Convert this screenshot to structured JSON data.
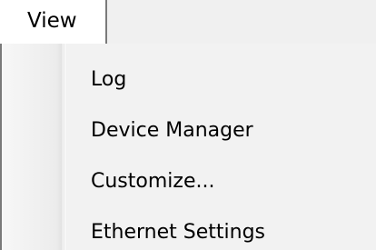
{
  "menubar": {
    "open_menu_title": "View"
  },
  "view_menu": {
    "items": [
      {
        "label": "Log"
      },
      {
        "label": "Device Manager"
      },
      {
        "label": "Customize..."
      },
      {
        "label": "Ethernet Settings"
      }
    ]
  },
  "colors": {
    "menubar_background": "#f0f0f0",
    "dropdown_background": "#f2f2f2",
    "border": "#7a7a7a",
    "text": "#000000"
  }
}
